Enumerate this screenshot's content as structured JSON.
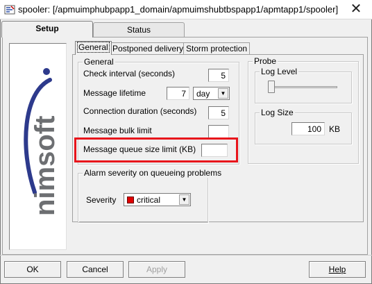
{
  "window": {
    "title": "spooler: [/apmuimphubpapp1_domain/apmuimshubtbspapp1/apmtapp1/spooler]",
    "close_glyph": "✕"
  },
  "tabs": [
    {
      "label": "Setup",
      "active": true
    },
    {
      "label": "Status",
      "active": false
    }
  ],
  "logo": {
    "text": "nimsoft"
  },
  "subtabs": [
    {
      "label": "General",
      "active": true
    },
    {
      "label": "Postponed delivery",
      "active": false
    },
    {
      "label": "Storm protection",
      "active": false
    }
  ],
  "general": {
    "legend": "General",
    "check_interval": {
      "label": "Check interval (seconds)",
      "value": "5"
    },
    "message_lifetime": {
      "label": "Message lifetime",
      "value": "7",
      "unit": "day"
    },
    "connection_duration": {
      "label": "Connection duration (seconds)",
      "value": "5"
    },
    "bulk_limit": {
      "label": "Message bulk limit",
      "value": ""
    },
    "queue_size_limit": {
      "label": "Message queue size limit (KB)",
      "value": ""
    }
  },
  "probe": {
    "legend": "Probe",
    "log_level": {
      "legend": "Log Level",
      "value": 0
    },
    "log_size": {
      "legend": "Log Size",
      "value": "100",
      "unit": "KB"
    }
  },
  "alarm": {
    "legend": "Alarm severity on queueing problems",
    "severity_label": "Severity",
    "severity_value": "critical",
    "severity_color": "#e00000"
  },
  "buttons": {
    "ok": "OK",
    "cancel": "Cancel",
    "apply": "Apply",
    "help": "Help"
  },
  "colors": {
    "highlight": "#e8141b",
    "logo_blue": "#2d3a8c",
    "logo_gray": "#6d6f72"
  }
}
